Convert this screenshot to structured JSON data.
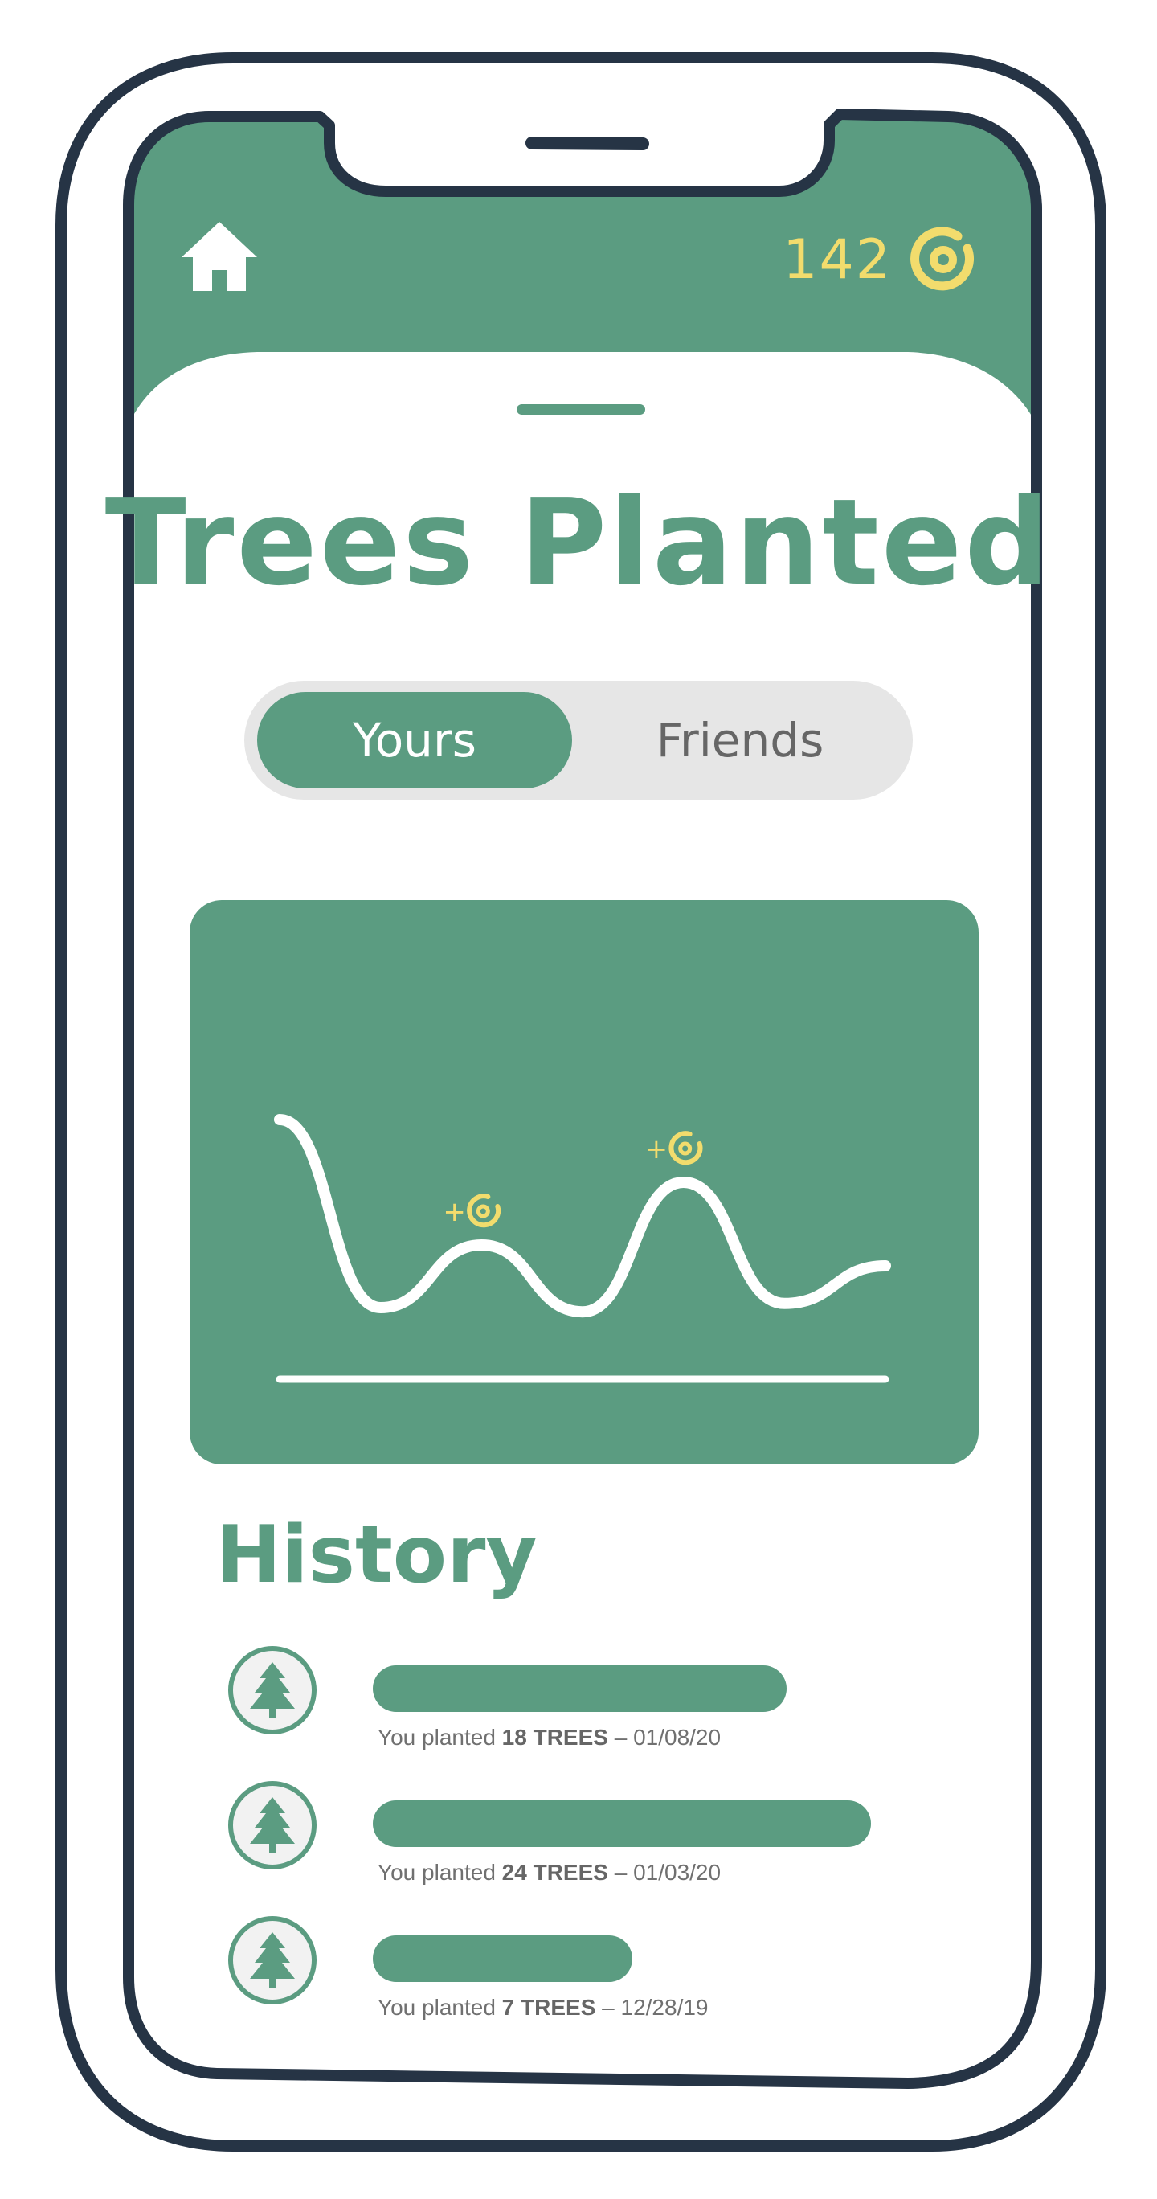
{
  "header": {
    "coin_balance": "142",
    "home_icon": "home-icon",
    "coin_icon": "coin-icon"
  },
  "page": {
    "title": "Trees Planted"
  },
  "toggle": {
    "selected": "Yours",
    "options": [
      "Yours",
      "Friends"
    ]
  },
  "chart_data": {
    "type": "line",
    "series": [
      {
        "values": [
          0.95,
          0.05,
          0.35,
          0.03,
          0.65,
          0.07,
          0.25
        ]
      }
    ],
    "markers": [
      {
        "label": "+",
        "icon": "coin-icon",
        "at_index": 2
      },
      {
        "label": "+",
        "icon": "coin-icon",
        "at_index": 4
      }
    ],
    "xlabel": "",
    "ylabel": "",
    "title": "",
    "grid": false,
    "colors": {
      "line": "#ffffff",
      "marker": "#f2dc6d",
      "background": "#5b9c81"
    }
  },
  "history": {
    "title": "History",
    "items": [
      {
        "prefix": "You planted ",
        "amount": "18 TREES",
        "suffix": " – 01/08/20",
        "trees": 18,
        "icon": "tree-icon"
      },
      {
        "prefix": "You planted ",
        "amount": "24 TREES",
        "suffix": " – 01/03/20",
        "trees": 24,
        "icon": "tree-icon"
      },
      {
        "prefix": "You planted ",
        "amount": "7 TREES",
        "suffix": " – 12/28/19",
        "trees": 7,
        "icon": "tree-icon"
      }
    ]
  },
  "colors": {
    "accent": "#5b9c81",
    "coin": "#f2dc6d",
    "outline": "#263445",
    "toggle_bg": "#e6e6e6"
  }
}
